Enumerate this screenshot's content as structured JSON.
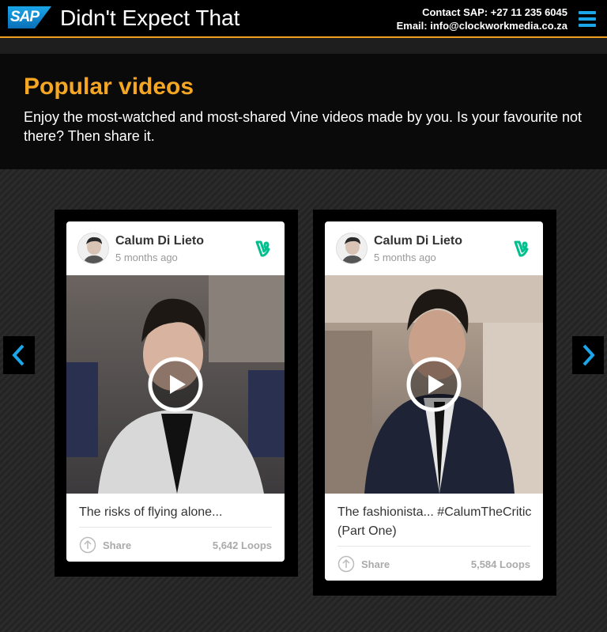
{
  "header": {
    "logo_text": "SAP",
    "title": "Didn't Expect That",
    "contact_line": "Contact SAP: +27 11 235 6045",
    "email_line": "Email: info@clockworkmedia.co.za",
    "accent_color": "#f0a020",
    "brand_color": "#1aa6e8"
  },
  "intro": {
    "heading": "Popular videos",
    "description": "Enjoy the most-watched and most-shared Vine videos made by you. Is your favourite not there? Then share it."
  },
  "carousel": {
    "prev_icon": "chevron-left-icon",
    "next_icon": "chevron-right-icon",
    "cards": [
      {
        "author": "Calum Di Lieto",
        "age": "5 months ago",
        "caption": "The risks of flying alone...",
        "share_label": "Share",
        "loops": "5,642 Loops"
      },
      {
        "author": "Calum Di Lieto",
        "age": "5 months ago",
        "caption": "The fashionista... #CalumTheCritic (Part One)",
        "share_label": "Share",
        "loops": "5,584 Loops"
      }
    ]
  },
  "colors": {
    "vine_green": "#00bf8f",
    "heading_orange": "#f5a623"
  }
}
